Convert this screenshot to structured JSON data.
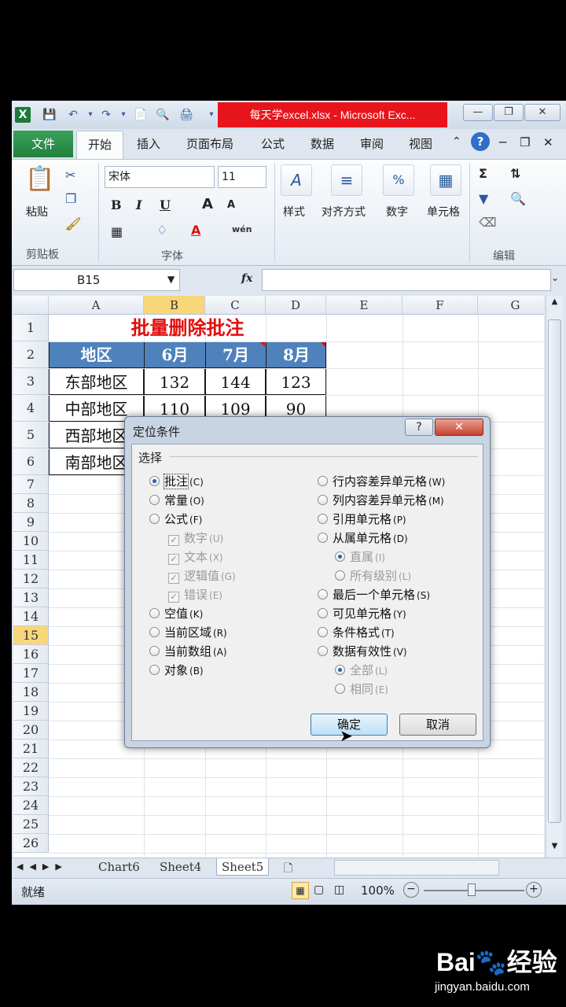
{
  "window": {
    "title": "每天学excel.xlsx - Microsoft Exc...",
    "minimize": "—",
    "restore": "❐",
    "close": "✕"
  },
  "tabs": [
    "文件",
    "开始",
    "插入",
    "页面布局",
    "公式",
    "数据",
    "审阅",
    "视图"
  ],
  "ribbon": {
    "paste": "粘贴",
    "clipboard": "剪贴板",
    "font_name": "宋体",
    "font_size": "11",
    "font_group": "字体",
    "styles": "样式",
    "align": "对齐方式",
    "number": "数字",
    "cells": "单元格",
    "editing": "编辑",
    "bold": "B",
    "italic": "I",
    "underline": "U",
    "grow": "A",
    "shrink": "A",
    "wen": "wén"
  },
  "formula_bar": {
    "name_box": "B15",
    "fx": "fx",
    "content": ""
  },
  "sheet": {
    "columns": [
      "A",
      "B",
      "C",
      "D",
      "E",
      "F",
      "G"
    ],
    "rows": [
      "1",
      "2",
      "3",
      "4",
      "5",
      "6",
      "7",
      "8",
      "9",
      "10",
      "11",
      "12",
      "13",
      "14",
      "15",
      "16",
      "17",
      "18",
      "19",
      "20",
      "21",
      "22",
      "23",
      "24",
      "25",
      "26"
    ],
    "title": "批量删除批注",
    "header": [
      "地区",
      "6月",
      "7月",
      "8月"
    ],
    "data": [
      [
        "东部地区",
        "132",
        "144",
        "123"
      ],
      [
        "中部地区",
        "110",
        "109",
        "90"
      ],
      [
        "西部地区",
        "",
        "",
        ""
      ],
      [
        "南部地区",
        "",
        "",
        ""
      ]
    ],
    "active_row": "15",
    "active_col": "B"
  },
  "sheet_tabs": [
    "Chart6",
    "Sheet4",
    "Sheet5"
  ],
  "status": {
    "ready": "就绪",
    "zoom": "100%"
  },
  "dialog": {
    "title": "定位条件",
    "help": "?",
    "close": "✕",
    "group": "选择",
    "left_options": [
      {
        "label": "批注",
        "key": "(C)",
        "checked": true
      },
      {
        "label": "常量",
        "key": "(O)",
        "checked": false
      },
      {
        "label": "公式",
        "key": "(F)",
        "checked": false
      },
      {
        "label": "数字",
        "key": "(U)",
        "sub": true
      },
      {
        "label": "文本",
        "key": "(X)",
        "sub": true
      },
      {
        "label": "逻辑值",
        "key": "(G)",
        "sub": true
      },
      {
        "label": "错误",
        "key": "(E)",
        "sub": true
      },
      {
        "label": "空值",
        "key": "(K)",
        "checked": false
      },
      {
        "label": "当前区域",
        "key": "(R)",
        "checked": false
      },
      {
        "label": "当前数组",
        "key": "(A)",
        "checked": false
      },
      {
        "label": "对象",
        "key": "(B)",
        "checked": false
      }
    ],
    "right_options": [
      {
        "label": "行内容差异单元格",
        "key": "(W)"
      },
      {
        "label": "列内容差异单元格",
        "key": "(M)"
      },
      {
        "label": "引用单元格",
        "key": "(P)"
      },
      {
        "label": "从属单元格",
        "key": "(D)"
      },
      {
        "label": "直属",
        "key": "(I)",
        "sub": true,
        "checked": true
      },
      {
        "label": "所有级别",
        "key": "(L)",
        "sub": true
      },
      {
        "label": "最后一个单元格",
        "key": "(S)"
      },
      {
        "label": "可见单元格",
        "key": "(Y)"
      },
      {
        "label": "条件格式",
        "key": "(T)"
      },
      {
        "label": "数据有效性",
        "key": "(V)"
      },
      {
        "label": "全部",
        "key": "(L)",
        "sub": true,
        "checked": true
      },
      {
        "label": "相同",
        "key": "(E)",
        "sub": true
      }
    ],
    "ok": "确定",
    "cancel": "取消"
  },
  "colors": {
    "title_red": "#e8141b",
    "header_blue": "#4f81bd",
    "sheet_title": "#e30e0e",
    "file_tab": "#21803d"
  }
}
